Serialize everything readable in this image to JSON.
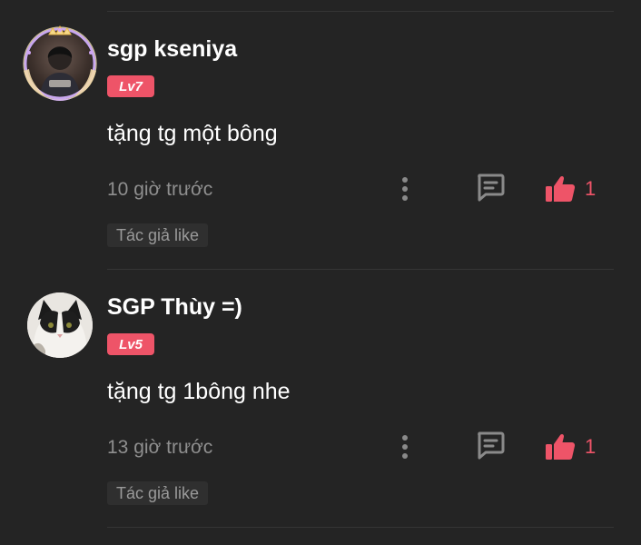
{
  "comments": [
    {
      "username": "sgp kseniya",
      "level": "Lv7",
      "text": "tặng tg một bông",
      "time": "10 giờ trước",
      "likes": "1",
      "author_like": "Tác giả like",
      "avatar_icon": "user-photo-avatar-with-frame"
    },
    {
      "username": "SGP Thùy =)",
      "level": "Lv5",
      "text": "tặng tg 1bông nhe",
      "time": "13 giờ trước",
      "likes": "1",
      "author_like": "Tác giả like",
      "avatar_icon": "cat-photo-avatar"
    }
  ],
  "colors": {
    "background": "#242424",
    "accent": "#ee5468",
    "muted_text": "#8f8f8f",
    "icon_gray": "#8a8a8a"
  }
}
